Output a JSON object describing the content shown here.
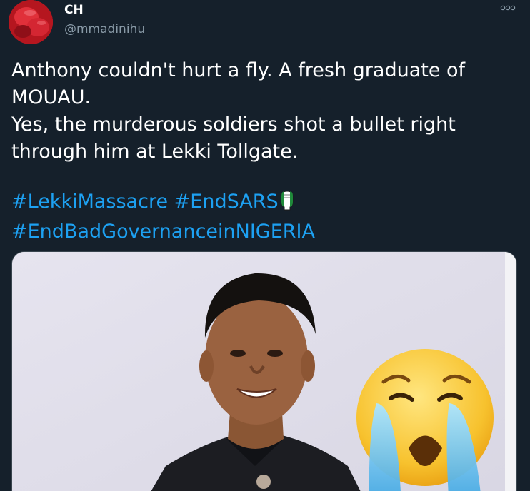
{
  "tweet": {
    "author": {
      "name": "CH",
      "handle": "@mmadinihu",
      "avatar_icon": "boxing-glove-avatar"
    },
    "more_icon": "more-options-icon",
    "text_lines": [
      "Anthony couldn't hurt a fly. A fresh graduate of MOUAU.",
      "Yes, the murderous soldiers shot a bullet right through him at Lekki Tollgate."
    ],
    "hashtags": [
      "#LekkiMassacre",
      "#EndSARS",
      "#EndBadGovernanceinNIGERIA"
    ],
    "emoji": "raised-fist-nigeria-flag-icon",
    "media": {
      "description_icon": "photo-of-young-man-with-crying-emoji",
      "emoji_icon": "loudly-crying-face-icon"
    }
  },
  "colors": {
    "background": "#15202b",
    "text": "#ffffff",
    "secondary": "#8899a6",
    "link": "#1da1f2"
  }
}
